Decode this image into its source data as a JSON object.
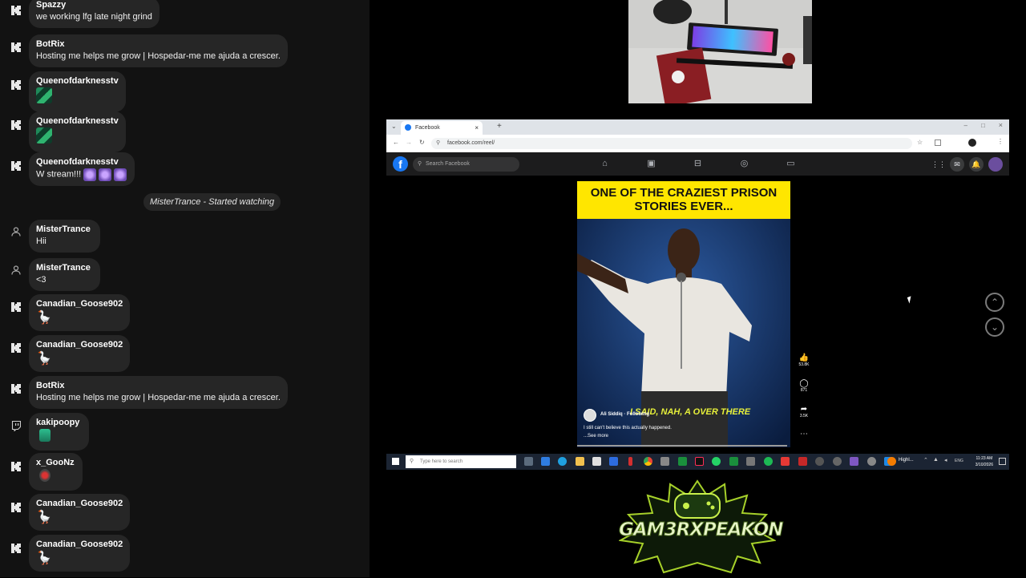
{
  "chat": {
    "messages": [
      {
        "user": "Spazzy",
        "text": "we working lfg late night grind",
        "platform": "kick-icon"
      },
      {
        "user": "BotRix",
        "text": "Hosting me helps me grow | Hospedar-me me ajuda a crescer.",
        "platform": "kick-icon"
      },
      {
        "user": "Queenofdarknesstv",
        "text": "",
        "platform": "kick-icon"
      },
      {
        "user": "Queenofdarknesstv",
        "text": "",
        "platform": "kick-icon"
      },
      {
        "user": "Queenofdarknesstv",
        "text": "W stream!!!",
        "platform": "kick-icon"
      },
      {
        "user": "MisterTrance",
        "text": "Hii",
        "platform": "person-icon"
      },
      {
        "user": "MisterTrance",
        "text": "<3",
        "platform": "person-icon"
      },
      {
        "user": "Canadian_Goose902",
        "text": "",
        "platform": "kick-icon"
      },
      {
        "user": "Canadian_Goose902",
        "text": "",
        "platform": "kick-icon"
      },
      {
        "user": "BotRix",
        "text": "Hosting me helps me grow | Hospedar-me me ajuda a crescer.",
        "platform": "kick-icon"
      },
      {
        "user": "kakipoopy",
        "text": "",
        "platform": "twitch-icon"
      },
      {
        "user": "x_GooNz",
        "text": "",
        "platform": "kick-icon"
      },
      {
        "user": "Canadian_Goose902",
        "text": "",
        "platform": "kick-icon"
      },
      {
        "user": "Canadian_Goose902",
        "text": "",
        "platform": "kick-icon"
      }
    ],
    "system_event": "MisterTrance - Started watching"
  },
  "browser": {
    "tab_title": "Facebook",
    "url": "facebook.com/reel/",
    "search_placeholder": "Search Facebook"
  },
  "reel": {
    "banner": "ONE OF THE CRAZIEST PRISON STORIES EVER...",
    "caption_overlay": "I SAID, NAH, A OVER THERE",
    "author": "Ali Siddiq",
    "follow": "Following",
    "description": "I still can't believe this actually happened.",
    "see_more": "...See more",
    "likes": "53.8K",
    "comments": "871",
    "shares": "3.5K"
  },
  "taskbar": {
    "search_placeholder": "Type here to search",
    "active_app": "Highl...",
    "lang": "ENG",
    "time": "11:23 AM",
    "date": "3/10/2026"
  },
  "logo_text": "GAM3RXPEAKON",
  "colors": {
    "chat_bg": "#121212",
    "bubble": "#262626",
    "kick_green": "#53fc18",
    "fb_blue": "#1877f2",
    "banner_yellow": "#ffe600",
    "logo_green": "#a7d12a"
  }
}
